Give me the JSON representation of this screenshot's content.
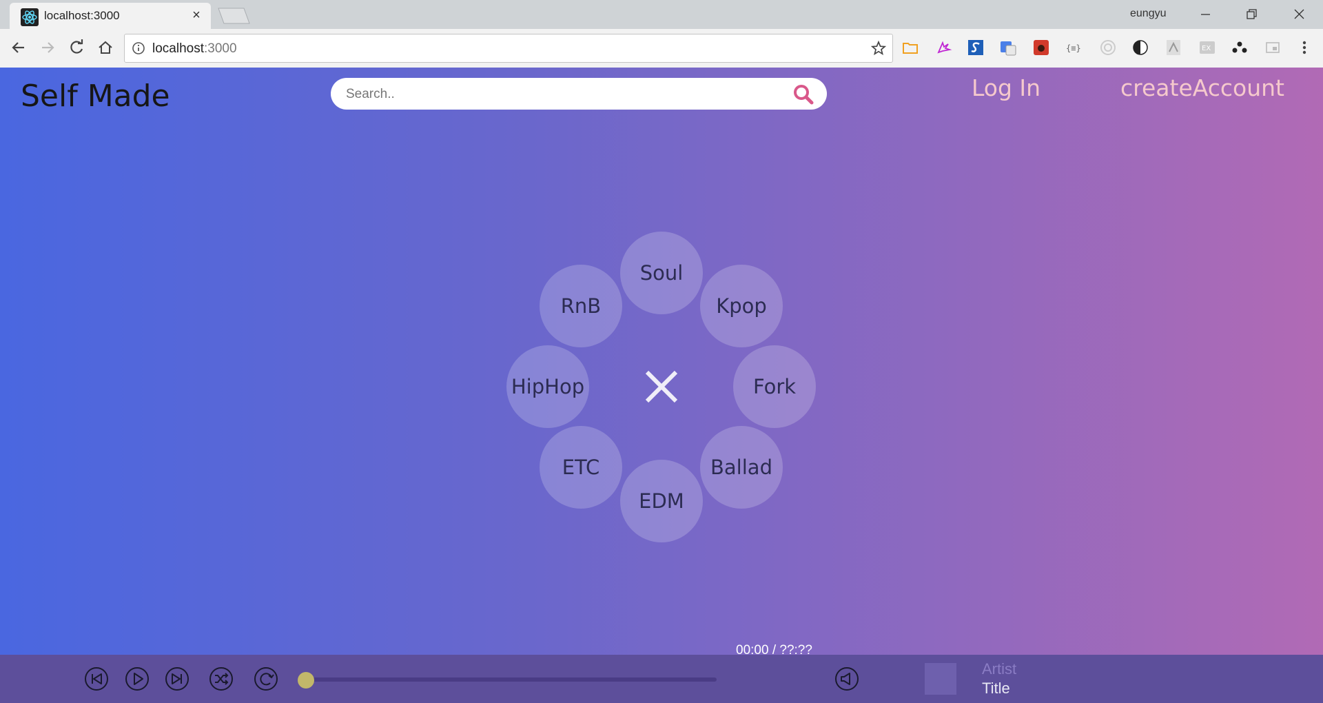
{
  "browser": {
    "tab_title": "localhost:3000",
    "tab_close": "×",
    "profile_name": "eungyu",
    "url_host": "localhost",
    "url_port": ":3000"
  },
  "app": {
    "logo": "Self Made",
    "search_placeholder": "Search..",
    "login_label": "Log In",
    "create_account_label": "createAccount"
  },
  "genres": [
    "Soul",
    "Kpop",
    "Fork",
    "Ballad",
    "EDM",
    "ETC",
    "HipHop",
    "RnB"
  ],
  "player": {
    "time": "00:00 / ??:??",
    "progress": 0,
    "artist": "Artist",
    "title": "Title"
  },
  "colors": {
    "gradient_start": "#4a67e0",
    "gradient_end": "#b16ab5",
    "player_bar": "#5d4f9b",
    "nav_link": "#f5c9cc",
    "search_icon": "#d9588a",
    "progress_knob": "#c2b76a"
  }
}
